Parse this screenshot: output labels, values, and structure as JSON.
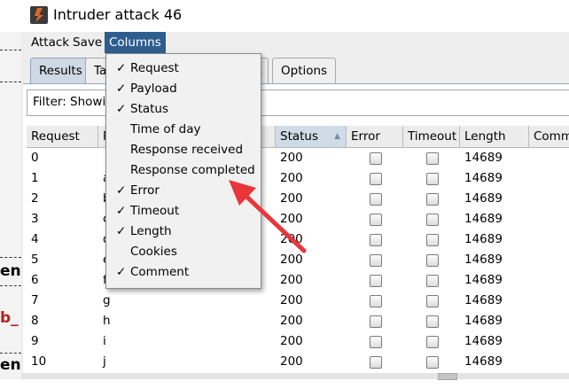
{
  "window": {
    "title": "Intruder attack 46"
  },
  "menu": {
    "attack": "Attack",
    "save": "Save",
    "columns": "Columns"
  },
  "tabs": {
    "results": "Results",
    "partial_left": "Ta",
    "partial_right": "s",
    "options": "Options"
  },
  "filter": {
    "text": "Filter: Showin"
  },
  "columns": {
    "request": "Request",
    "payload": "P",
    "status": "Status",
    "error": "Error",
    "timeout": "Timeout",
    "length": "Length",
    "comment": "Comm"
  },
  "rows": [
    {
      "request": "0",
      "payload": "",
      "status": "200",
      "length": "14689"
    },
    {
      "request": "1",
      "payload": "a",
      "status": "200",
      "length": "14689"
    },
    {
      "request": "2",
      "payload": "b",
      "status": "200",
      "length": "14689"
    },
    {
      "request": "3",
      "payload": "c",
      "status": "200",
      "length": "14689"
    },
    {
      "request": "4",
      "payload": "d",
      "status": "200",
      "length": "14689"
    },
    {
      "request": "5",
      "payload": "e",
      "status": "200",
      "length": "14689"
    },
    {
      "request": "6",
      "payload": "f",
      "status": "200",
      "length": "14689"
    },
    {
      "request": "7",
      "payload": "g",
      "status": "200",
      "length": "14689"
    },
    {
      "request": "8",
      "payload": "h",
      "status": "200",
      "length": "14689"
    },
    {
      "request": "9",
      "payload": "i",
      "status": "200",
      "length": "14689"
    },
    {
      "request": "10",
      "payload": "j",
      "status": "200",
      "length": "14689"
    }
  ],
  "columns_menu": {
    "items": [
      {
        "label": "Request",
        "checked": true,
        "check": "✓"
      },
      {
        "label": "Payload",
        "checked": true,
        "check": "✓"
      },
      {
        "label": "Status",
        "checked": true,
        "check": "✓"
      },
      {
        "label": "Time of day",
        "checked": false,
        "check": ""
      },
      {
        "label": "Response received",
        "checked": false,
        "check": ""
      },
      {
        "label": "Response completed",
        "checked": false,
        "check": ""
      },
      {
        "label": "Error",
        "checked": true,
        "check": "✓"
      },
      {
        "label": "Timeout",
        "checked": true,
        "check": "✓"
      },
      {
        "label": "Length",
        "checked": true,
        "check": "✓"
      },
      {
        "label": "Cookies",
        "checked": false,
        "check": ""
      },
      {
        "label": "Comment",
        "checked": true,
        "check": "✓"
      }
    ]
  },
  "background_text": {
    "a": "ent",
    "b": "b_",
    "c": "ent"
  },
  "colors": {
    "menu_active": "#2d5e8f",
    "annotation_arrow": "#e8363b",
    "app_icon": "#e06a2a"
  }
}
